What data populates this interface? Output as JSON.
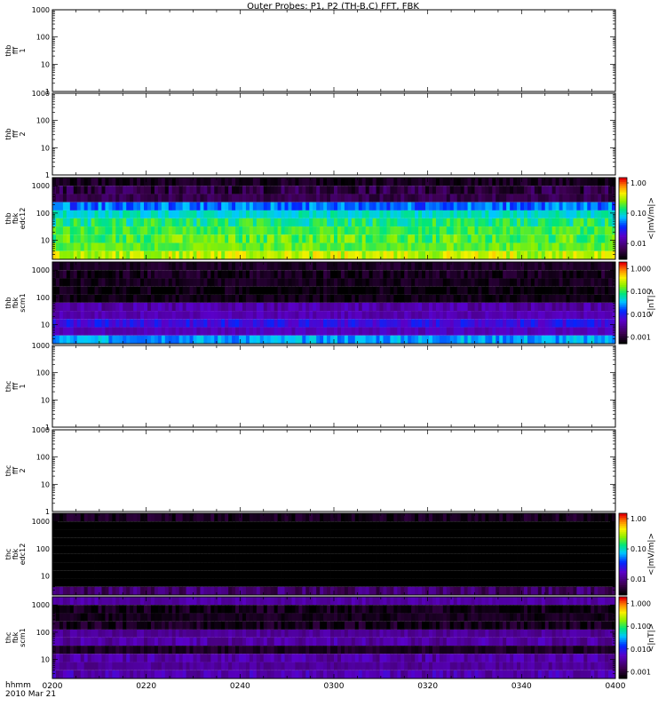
{
  "title": "Outer Probes: P1, P2 (TH-B,C) FFT, FBK",
  "time_axis": {
    "label_line1": "hhmm",
    "label_line2": "2010 Mar 21",
    "ticks": [
      "0200",
      "0220",
      "0240",
      "0300",
      "0320",
      "0340",
      "0400"
    ]
  },
  "chart_data": [
    {
      "type": "line",
      "name_lines": [
        "thb",
        "fff",
        "1"
      ],
      "yscale": "log",
      "ylim": [
        1,
        1000
      ],
      "yticks": [
        "1",
        "10",
        "100",
        "1000"
      ],
      "has_colorbar": false
    },
    {
      "type": "line",
      "name_lines": [
        "thb",
        "fff",
        "2"
      ],
      "yscale": "log",
      "ylim": [
        1,
        1000
      ],
      "yticks": [
        "1",
        "10",
        "100",
        "1000"
      ],
      "has_colorbar": false
    },
    {
      "type": "heatmap",
      "name_lines": [
        "thb",
        "fbk",
        "edc12"
      ],
      "yscale": "log",
      "ylim": [
        2,
        2000
      ],
      "yticks": [
        "10",
        "100",
        "1000"
      ],
      "has_colorbar": true,
      "colorbar": {
        "label": "<|mV/m|>",
        "ticks": [
          "0.01",
          "0.10",
          "1.00"
        ],
        "scale": "log",
        "range": [
          0.003,
          1.5
        ]
      },
      "bands": [
        {
          "freq_lo": 1000,
          "freq_hi": 2000,
          "level": 0.004
        },
        {
          "freq_lo": 500,
          "freq_hi": 1000,
          "level": 0.0055
        },
        {
          "freq_lo": 250,
          "freq_hi": 500,
          "level": 0.006
        },
        {
          "freq_lo": 125,
          "freq_hi": 250,
          "level": 0.05
        },
        {
          "freq_lo": 64,
          "freq_hi": 125,
          "level": 0.1
        },
        {
          "freq_lo": 32,
          "freq_hi": 64,
          "level": 0.14
        },
        {
          "freq_lo": 16,
          "freq_hi": 32,
          "level": 0.18
        },
        {
          "freq_lo": 8,
          "freq_hi": 16,
          "level": 0.2
        },
        {
          "freq_lo": 4,
          "freq_hi": 8,
          "level": 0.22
        },
        {
          "freq_lo": 2,
          "freq_hi": 4,
          "level": 0.35
        }
      ]
    },
    {
      "type": "heatmap",
      "name_lines": [
        "thb",
        "fbk",
        "scm1"
      ],
      "yscale": "log",
      "ylim": [
        2,
        2000
      ],
      "yticks": [
        "10",
        "100",
        "1000"
      ],
      "has_colorbar": true,
      "colorbar": {
        "label": "<|nT|>",
        "ticks": [
          "0.001",
          "0.010",
          "0.100",
          "1.000"
        ],
        "scale": "log",
        "range": [
          0.0005,
          2
        ]
      },
      "bands": [
        {
          "freq_lo": 1000,
          "freq_hi": 2000,
          "level": 0.0008
        },
        {
          "freq_lo": 500,
          "freq_hi": 1000,
          "level": 0.0007
        },
        {
          "freq_lo": 250,
          "freq_hi": 500,
          "level": 0.0007
        },
        {
          "freq_lo": 125,
          "freq_hi": 250,
          "level": 0.00055
        },
        {
          "freq_lo": 64,
          "freq_hi": 125,
          "level": 0.00065
        },
        {
          "freq_lo": 32,
          "freq_hi": 64,
          "level": 0.0035
        },
        {
          "freq_lo": 16,
          "freq_hi": 32,
          "level": 0.004
        },
        {
          "freq_lo": 8,
          "freq_hi": 16,
          "level": 0.008
        },
        {
          "freq_lo": 4,
          "freq_hi": 8,
          "level": 0.0045
        },
        {
          "freq_lo": 2,
          "freq_hi": 4,
          "level": 0.03
        }
      ]
    },
    {
      "type": "line",
      "name_lines": [
        "thc",
        "fff",
        "1"
      ],
      "yscale": "log",
      "ylim": [
        1,
        1000
      ],
      "yticks": [
        "1",
        "10",
        "100",
        "1000"
      ],
      "has_colorbar": false
    },
    {
      "type": "line",
      "name_lines": [
        "thc",
        "fff",
        "2"
      ],
      "yscale": "log",
      "ylim": [
        1,
        1000
      ],
      "yticks": [
        "1",
        "10",
        "100",
        "1000"
      ],
      "has_colorbar": false
    },
    {
      "type": "heatmap",
      "name_lines": [
        "thc",
        "fbk",
        "edc12"
      ],
      "yscale": "log",
      "ylim": [
        2,
        2000
      ],
      "yticks": [
        "10",
        "100",
        "1000"
      ],
      "has_colorbar": true,
      "colorbar": {
        "label": "<|mV/m|>",
        "ticks": [
          "0.01",
          "0.10",
          "1.00"
        ],
        "scale": "log",
        "range": [
          0.003,
          1.5
        ]
      },
      "bands": [
        {
          "freq_lo": 1000,
          "freq_hi": 2000,
          "level": 0.004
        },
        {
          "freq_lo": 500,
          "freq_hi": 1000,
          "level": 0.0001
        },
        {
          "freq_lo": 250,
          "freq_hi": 500,
          "level": 0.0001
        },
        {
          "freq_lo": 125,
          "freq_hi": 250,
          "level": 0.0001
        },
        {
          "freq_lo": 64,
          "freq_hi": 125,
          "level": 0.0001
        },
        {
          "freq_lo": 32,
          "freq_hi": 64,
          "level": 0.0001
        },
        {
          "freq_lo": 16,
          "freq_hi": 32,
          "level": 0.0001
        },
        {
          "freq_lo": 8,
          "freq_hi": 16,
          "level": 0.0001
        },
        {
          "freq_lo": 4,
          "freq_hi": 8,
          "level": 0.0001
        },
        {
          "freq_lo": 2,
          "freq_hi": 4,
          "level": 0.008
        }
      ]
    },
    {
      "type": "heatmap",
      "name_lines": [
        "thc",
        "fbk",
        "scm1"
      ],
      "yscale": "log",
      "ylim": [
        2,
        2000
      ],
      "yticks": [
        "10",
        "100",
        "1000"
      ],
      "has_colorbar": true,
      "colorbar": {
        "label": "<|nT|>",
        "ticks": [
          "0.001",
          "0.010",
          "0.100",
          "1.000"
        ],
        "scale": "log",
        "range": [
          0.0005,
          2
        ]
      },
      "bands": [
        {
          "freq_lo": 1000,
          "freq_hi": 2000,
          "level": 0.0035
        },
        {
          "freq_lo": 500,
          "freq_hi": 1000,
          "level": 0.00065
        },
        {
          "freq_lo": 250,
          "freq_hi": 500,
          "level": 0.0007
        },
        {
          "freq_lo": 125,
          "freq_hi": 250,
          "level": 0.0007
        },
        {
          "freq_lo": 64,
          "freq_hi": 125,
          "level": 0.003
        },
        {
          "freq_lo": 32,
          "freq_hi": 64,
          "level": 0.0035
        },
        {
          "freq_lo": 16,
          "freq_hi": 32,
          "level": 0.0008
        },
        {
          "freq_lo": 8,
          "freq_hi": 16,
          "level": 0.0035
        },
        {
          "freq_lo": 4,
          "freq_hi": 8,
          "level": 0.003
        },
        {
          "freq_lo": 2,
          "freq_hi": 4,
          "level": 0.004
        }
      ]
    }
  ]
}
